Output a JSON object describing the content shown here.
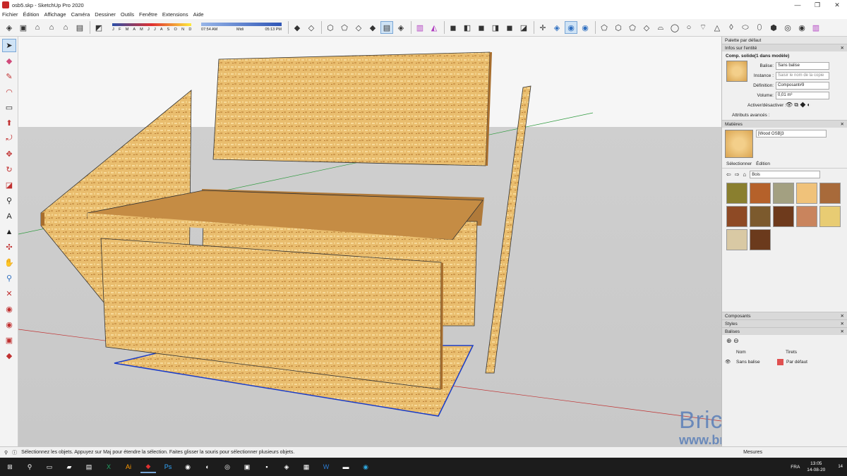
{
  "window": {
    "title": "osb5.skp - SketchUp Pro 2020",
    "min": "—",
    "max": "❐",
    "close": "✕"
  },
  "menu": [
    "Fichier",
    "Édition",
    "Affichage",
    "Caméra",
    "Dessiner",
    "Outils",
    "Fenêtre",
    "Extensions",
    "Aide"
  ],
  "shadow": {
    "months": "J F M A M J J A S O N D",
    "time_start": "07:54 AM",
    "time_mid": "Midi",
    "time_end": "05:13 PM"
  },
  "tray": {
    "title": "Palette par défaut",
    "entity": {
      "section": "Infos sur l'entité",
      "heading": "Comp. solide(1 dans modèle)",
      "tag_label": "Balise:",
      "tag_value": "Sans balise",
      "instance_label": "Instance :",
      "instance_placeholder": "Saisir le nom de la copie",
      "definition_label": "Définition:",
      "definition_value": "Composant#9",
      "volume_label": "Volume:",
      "volume_value": "0,01 m³",
      "toggle_label": "Activer/désactiver :",
      "advanced_label": "Attributs avancés :"
    },
    "materials": {
      "section": "Matières",
      "current": "[Wood OSB]3",
      "tab_select": "Sélectionner",
      "tab_edit": "Édition",
      "library": "Bois",
      "swatch_colors": [
        "#8a7f2f",
        "#b5612a",
        "#a3a081",
        "#f0c27a",
        "#a86a3a",
        "#8e4a25",
        "#7c5a2d",
        "#6e3a1c",
        "#c9845d",
        "#e8cc73",
        "#d9c9a4",
        "#6b3a1c"
      ]
    },
    "components": "Composants",
    "styles": "Styles",
    "tags": {
      "section": "Balises",
      "col_name": "Nom",
      "col_dash": "Tirets",
      "row_name": "Sans balise",
      "row_dash": "Par défaut"
    }
  },
  "status": {
    "message": "Sélectionnez les objets. Appuyez sur Maj pour étendre la sélection. Faites glisser la souris pour sélectionner plusieurs objets.",
    "measure_label": "Mesures"
  },
  "watermark": {
    "line1": "BricoZone",
    "line2": "www.bricozone.be"
  },
  "taskbar": {
    "lang": "FRA",
    "time": "13:05",
    "date": "14-08-20",
    "badge": "14"
  }
}
